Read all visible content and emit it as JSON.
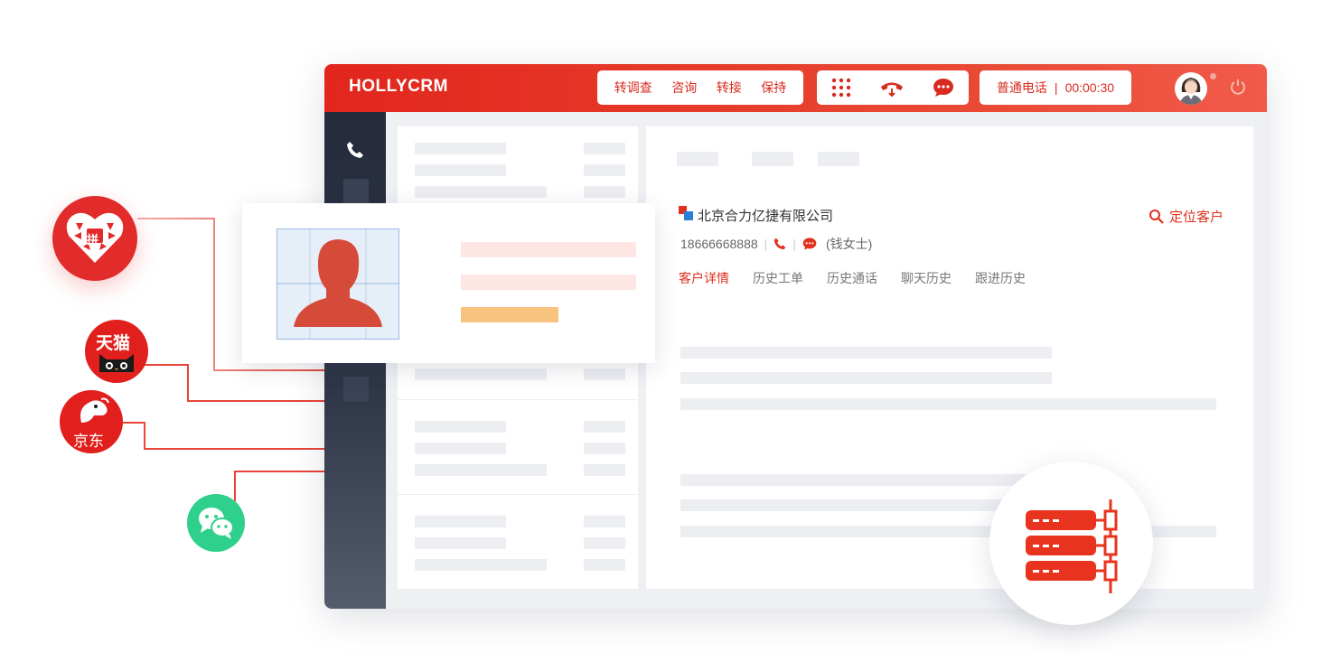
{
  "app": {
    "brand": "HOLLYCRM",
    "actions": [
      "转调查",
      "咨询",
      "转接",
      "保持"
    ],
    "call_status": {
      "type": "普通电话",
      "separator": "|",
      "timer": "00:00:30"
    }
  },
  "customer": {
    "company": "北京合力亿捷有限公司",
    "locate_label": "定位客户",
    "phone": "18666668888",
    "contact": "(钱女士)",
    "tabs": [
      "客户详情",
      "历史工单",
      "历史通话",
      "聊天历史",
      "跟进历史"
    ]
  },
  "channels": {
    "pdd_label": "拼",
    "tmall_label": "天猫",
    "jd_label": "京东"
  },
  "colors": {
    "primary": "#e2261d",
    "sidebar": "#252b3b",
    "wechat": "#2fd08c",
    "placeholder": "#eceef2"
  }
}
